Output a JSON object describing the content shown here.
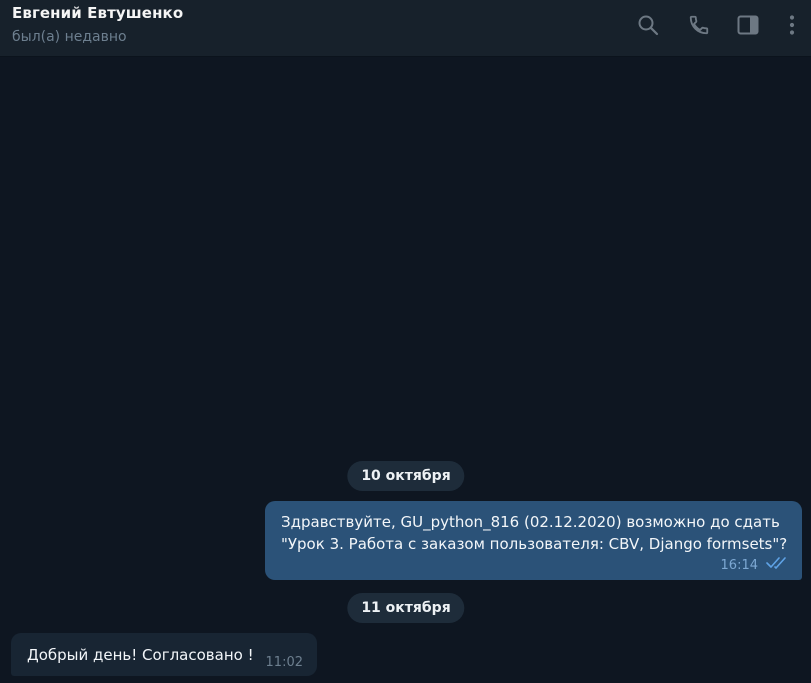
{
  "header": {
    "contact_name": "Евгений Евтушенко",
    "status": "был(а) недавно",
    "icons": [
      "search-icon",
      "phone-icon",
      "sidebar-toggle-icon",
      "more-vertical-icon"
    ]
  },
  "colors": {
    "background": "#0e1621",
    "header_bg": "#17212b",
    "outgoing_bubble": "#2b5278",
    "incoming_bubble": "#182533",
    "read_checks": "#5fa3e6",
    "icon": "#6d7883"
  },
  "messages": {
    "date1": "10 октября",
    "outgoing": {
      "text": "Здравствуйте, GU_python_816 (02.12.2020) возможно до сдать \"Урок 3. Работа с заказом пользователя: CBV, Django formsets\"?",
      "time": "16:14",
      "status_icon": "double-check-icon"
    },
    "date2": "11 октября",
    "incoming": {
      "text": "Добрый день! Согласовано !",
      "time": "11:02"
    }
  }
}
